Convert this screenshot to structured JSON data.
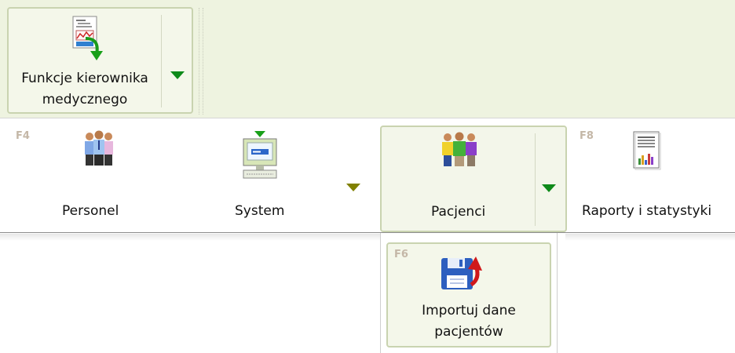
{
  "toolbar_top": {
    "manager_functions": {
      "label": "Funkcje kierownika medycznego",
      "icon": "report-export-icon",
      "dropdown_icon": "dropdown-arrow-icon"
    }
  },
  "ribbon": {
    "items": [
      {
        "key": "F4",
        "label": "Personel",
        "icon": "staff-people-icon"
      },
      {
        "key": "",
        "label": "System",
        "icon": "computer-terminal-icon",
        "has_dropdown": true
      },
      {
        "key": "",
        "label": "Pacjenci",
        "icon": "patients-group-icon",
        "has_dropdown": true,
        "active": true
      },
      {
        "key": "F8",
        "label": "Raporty i statystyki",
        "icon": "report-chart-icon"
      }
    ]
  },
  "dropdown": {
    "items": [
      {
        "key": "F6",
        "label": "Importuj dane pacjentów",
        "icon": "save-import-icon"
      }
    ]
  },
  "colors": {
    "ribbon_bg": "#eef3e0",
    "button_border": "#c9d3b0",
    "active_arrow": "#0e8a1a",
    "inactive_arrow": "#808000",
    "fkey": "#c4b7a7"
  }
}
